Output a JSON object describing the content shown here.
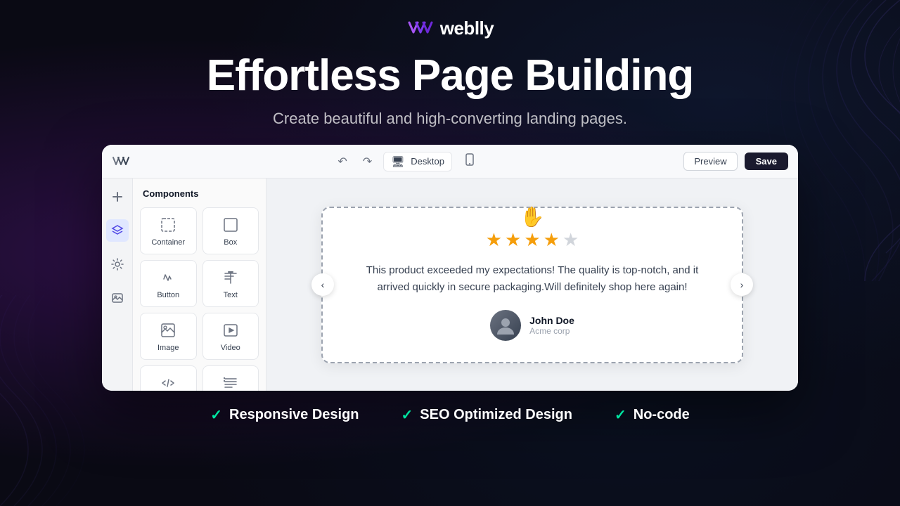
{
  "logo": {
    "text": "weblly",
    "icon_alt": "weblly logo"
  },
  "hero": {
    "title": "Effortless Page Building",
    "subtitle": "Create beautiful and high-converting landing pages."
  },
  "toolbar": {
    "device_label": "Desktop",
    "preview_label": "Preview",
    "save_label": "Save"
  },
  "components_panel": {
    "title": "Components",
    "items": [
      {
        "label": "Container",
        "icon": "container"
      },
      {
        "label": "Box",
        "icon": "box"
      },
      {
        "label": "Button",
        "icon": "button"
      },
      {
        "label": "Text",
        "icon": "text"
      },
      {
        "label": "Image",
        "icon": "image"
      },
      {
        "label": "Video",
        "icon": "video"
      },
      {
        "label": "Html",
        "icon": "html"
      },
      {
        "label": "List",
        "icon": "list"
      }
    ]
  },
  "testimonial": {
    "stars": 4,
    "max_stars": 5,
    "text": "This product exceeded my expectations! The quality is top-notch, and it arrived quickly in secure packaging.Will definitely shop here again!",
    "reviewer_name": "John Doe",
    "reviewer_company": "Acme corp"
  },
  "features": [
    {
      "label": "Responsive Design"
    },
    {
      "label": "SEO Optimized Design"
    },
    {
      "label": "No-code"
    }
  ]
}
